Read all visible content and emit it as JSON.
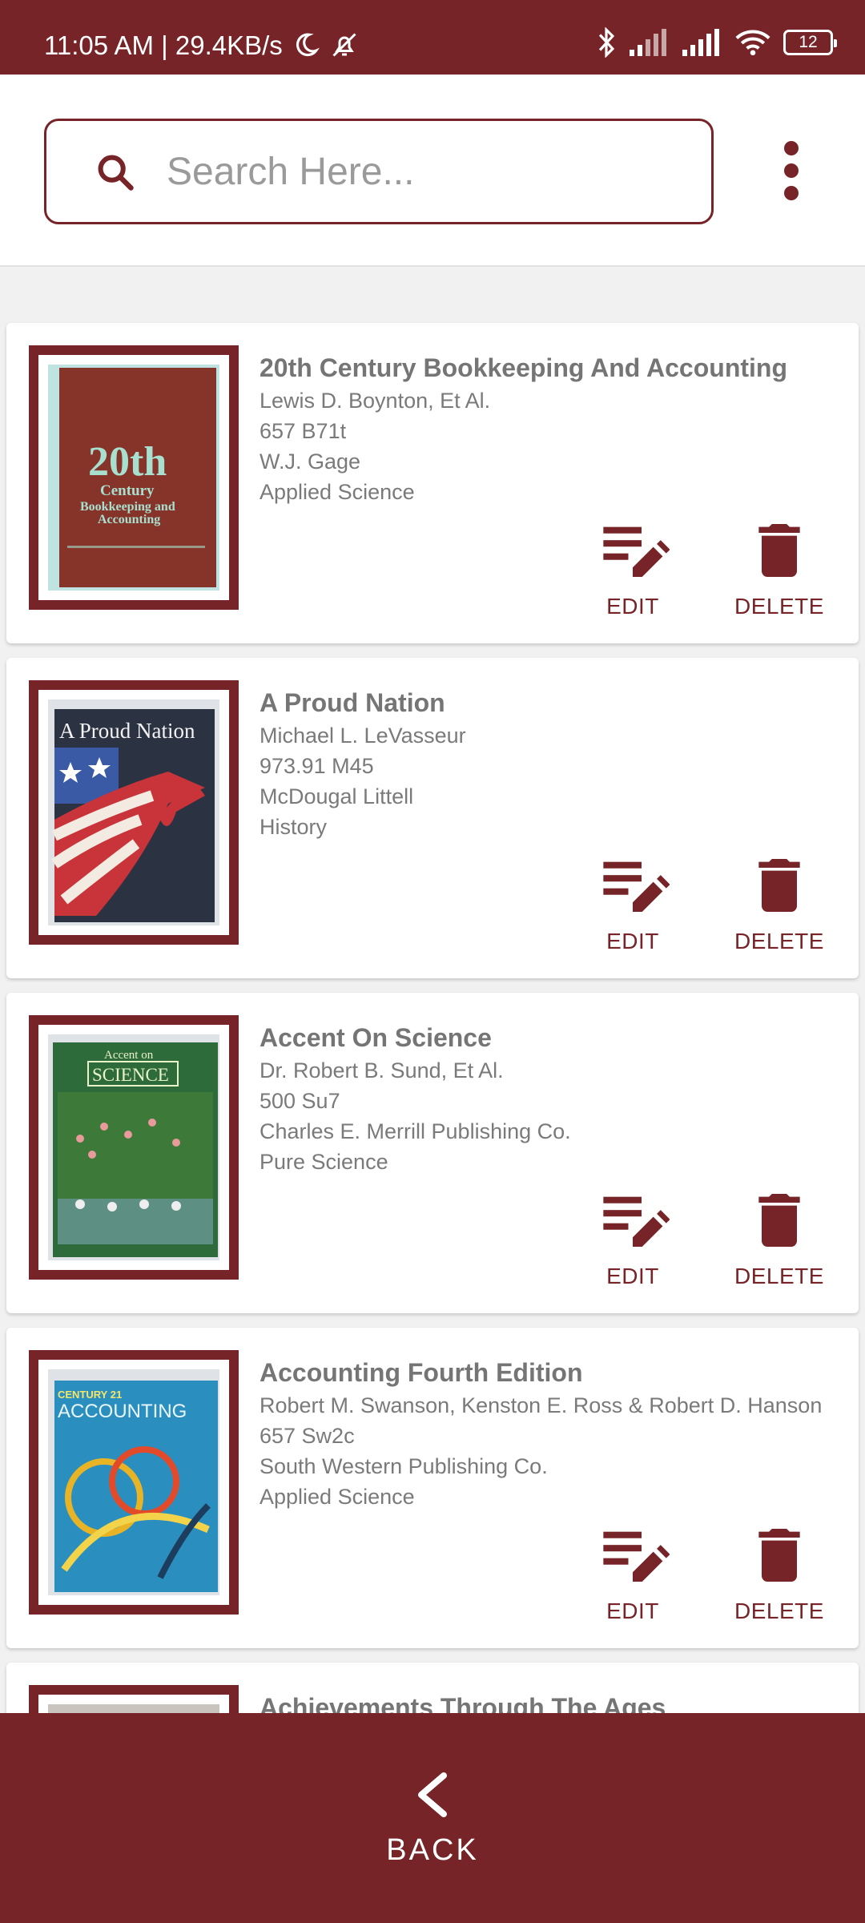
{
  "status_bar": {
    "time_speed": "11:05 AM | 29.4KB/s",
    "battery": "12",
    "icons": [
      "moon-icon",
      "alarm-off-icon",
      "bluetooth-icon",
      "signal-icon",
      "signal-icon",
      "wifi-icon",
      "battery-icon"
    ]
  },
  "search": {
    "placeholder": "Search Here...",
    "value": ""
  },
  "colors": {
    "brand": "#762427",
    "text_title": "#757575",
    "text_body": "#7a7a7a",
    "background": "#f1f1f1"
  },
  "books": [
    {
      "title": "20th Century Bookkeeping And Accounting",
      "author": "Lewis D. Boynton, Et Al.",
      "call_number": "657 B71t",
      "publisher": "W.J. Gage",
      "category": "Applied Science",
      "cover_text": [
        "20th",
        "Century",
        "Bookkeeping and",
        "Accounting"
      ],
      "edit_label": "EDIT",
      "delete_label": "DELETE"
    },
    {
      "title": "A Proud Nation",
      "author": "Michael L. LeVasseur",
      "call_number": "973.91 M45",
      "publisher": "McDougal Littell",
      "category": "History",
      "cover_text": [
        "A Proud Nation"
      ],
      "edit_label": "EDIT",
      "delete_label": "DELETE"
    },
    {
      "title": "Accent On Science",
      "author": "Dr. Robert B. Sund, Et Al.",
      "call_number": "500 Su7",
      "publisher": "Charles E. Merrill Publishing Co.",
      "category": "Pure Science",
      "cover_text": [
        "Accent on",
        "SCIENCE"
      ],
      "edit_label": "EDIT",
      "delete_label": "DELETE"
    },
    {
      "title": "Accounting Fourth Edition",
      "author": "Robert M. Swanson, Kenston E. Ross & Robert D. Hanson",
      "call_number": "657 Sw2c",
      "publisher": "South Western Publishing Co.",
      "category": "Applied Science",
      "cover_text": [
        "CENTURY 21",
        "ACCOUNTING"
      ],
      "edit_label": "EDIT",
      "delete_label": "DELETE"
    },
    {
      "title": "Achievements Through The Ages"
    }
  ],
  "bottom_bar": {
    "back_label": "BACK"
  }
}
